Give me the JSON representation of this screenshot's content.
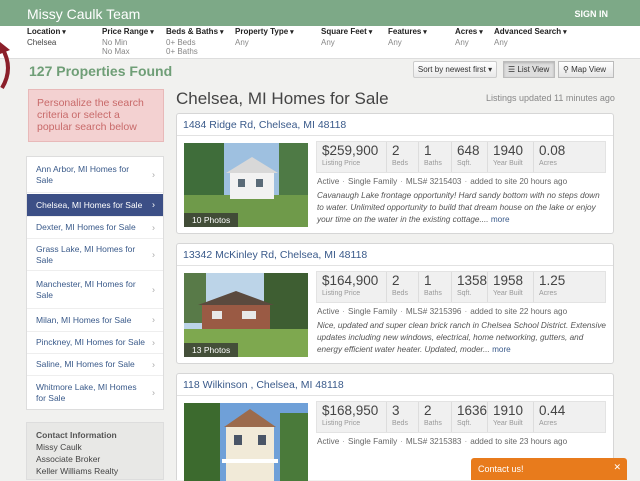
{
  "header": {
    "brand": "Missy Caulk Team",
    "signin": "SIGN IN"
  },
  "filters": [
    {
      "label": "Location",
      "values": [
        "Chelsea"
      ]
    },
    {
      "label": "Price Range",
      "values": [
        "No Min",
        "No Max"
      ]
    },
    {
      "label": "Beds & Baths",
      "values": [
        "0+ Beds",
        "0+ Baths"
      ]
    },
    {
      "label": "Property Type",
      "values": [
        "Any"
      ]
    },
    {
      "label": "Square Feet",
      "values": [
        "Any"
      ]
    },
    {
      "label": "Features",
      "values": [
        "Any"
      ]
    },
    {
      "label": "Acres",
      "values": [
        "Any"
      ]
    },
    {
      "label": "Advanced Search",
      "values": [
        "Any"
      ]
    }
  ],
  "results": {
    "count": "127 Properties Found",
    "sort": "Sort by newest first",
    "list_view": "List View",
    "map_view": "Map View"
  },
  "sidebar": {
    "personalize": "Personalize the search criteria or select a popular search below",
    "cities": [
      "Ann Arbor, MI Homes for Sale",
      "Chelsea, MI Homes for Sale",
      "Dexter, MI Homes for Sale",
      "Grass Lake, MI Homes for Sale",
      "Manchester, MI Homes for Sale",
      "Milan, MI Homes for Sale",
      "Pinckney, MI Homes for Sale",
      "Saline, MI Homes for Sale",
      "Whitmore Lake, MI Homes for Sale"
    ],
    "contact": {
      "heading": "Contact Information",
      "name": "Missy Caulk",
      "title": "Associate Broker",
      "company": "Keller Williams Realty"
    }
  },
  "main": {
    "heading": "Chelsea, MI Homes for Sale",
    "updated": "Listings updated 11 minutes ago"
  },
  "stat_units": [
    "Listing Price",
    "Beds",
    "Baths",
    "Sqft.",
    "Year Built",
    "Acres"
  ],
  "listings": [
    {
      "address": "1484 Ridge Rd, Chelsea, MI 48118",
      "photos": "10 Photos",
      "price": "$259,900",
      "beds": "2",
      "baths": "1",
      "sqft": "648",
      "year": "1940",
      "acres": "0.08",
      "status": "Active",
      "type": "Single Family",
      "mls": "MLS# 3215403",
      "added": "added to site 20 hours ago",
      "desc": "Cavanaugh Lake frontage opportunity! Hard sandy bottom with no steps down to water. Unlimited opportunity to build that dream house on the lake or enjoy your time on the water in the existing cottage....",
      "more": "more"
    },
    {
      "address": "13342 McKinley Rd, Chelsea, MI 48118",
      "photos": "13 Photos",
      "price": "$164,900",
      "beds": "2",
      "baths": "1",
      "sqft": "1358",
      "year": "1958",
      "acres": "1.25",
      "status": "Active",
      "type": "Single Family",
      "mls": "MLS# 3215396",
      "added": "added to site 22 hours ago",
      "desc": "Nice, updated and super clean brick ranch in Chelsea School District. Extensive updates including new windows, electrical, home networking, gutters, and energy efficient water heater. Updated, moder...",
      "more": "more"
    },
    {
      "address": "118 Wilkinson , Chelsea, MI 48118",
      "photos": "",
      "price": "$168,950",
      "beds": "3",
      "baths": "2",
      "sqft": "1636",
      "year": "1910",
      "acres": "0.44",
      "status": "Active",
      "type": "Single Family",
      "mls": "MLS# 3215383",
      "added": "added to site 23 hours ago",
      "desc": "",
      "more": ""
    }
  ],
  "contact_us": "Contact us!",
  "colors": {
    "brand_green": "#7da987",
    "count_green": "#6f9e77",
    "link_blue": "#3a5a8a",
    "active_city": "#3c4f86",
    "contact_orange": "#e87b1c"
  }
}
